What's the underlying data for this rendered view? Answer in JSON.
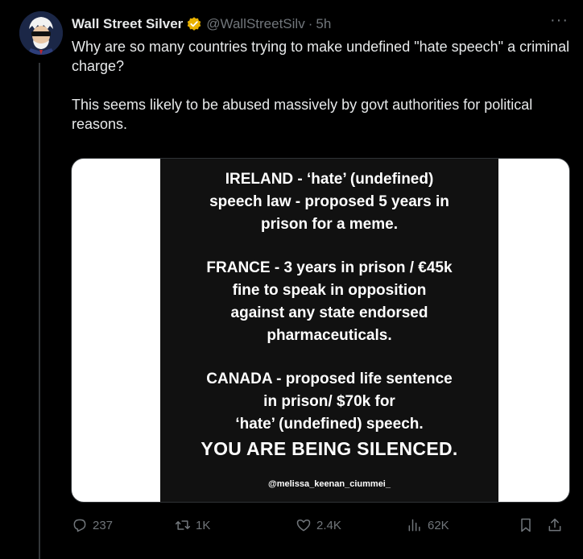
{
  "post": {
    "display_name": "Wall Street Silver",
    "handle": "@WallStreetSilv",
    "separator": "·",
    "time": "5h",
    "more": "···",
    "text_lines": [
      "Why are so many countries trying to make undefined \"hate speech\" a criminal charge?",
      "This seems likely to be abused massively by govt authorities for political reasons."
    ]
  },
  "media": {
    "block1": [
      "IRELAND - ‘hate’ (undefined)",
      "speech law  - proposed 5 years in",
      "prison for a meme."
    ],
    "block2": [
      "FRANCE - 3 years in prison / €45k",
      "fine to speak in opposition",
      "against any state endorsed",
      "pharmaceuticals."
    ],
    "block3": [
      "CANADA - proposed life sentence",
      "in prison/ $70k for",
      "‘hate’ (undefined) speech."
    ],
    "headline": "YOU ARE BEING SILENCED.",
    "credit": "@melissa_keenan_ciummei_"
  },
  "actions": {
    "reply_count": "237",
    "retweet_count": "1K",
    "like_count": "2.4K",
    "view_count": "62K"
  },
  "colors": {
    "background": "#000000",
    "text": "#e7e9ea",
    "secondary": "#71767b",
    "verified": "#e8b100"
  },
  "icons": [
    "avatar-icon",
    "verified-badge-icon",
    "reply-icon",
    "retweet-icon",
    "like-icon",
    "views-icon",
    "bookmark-icon",
    "share-icon"
  ]
}
